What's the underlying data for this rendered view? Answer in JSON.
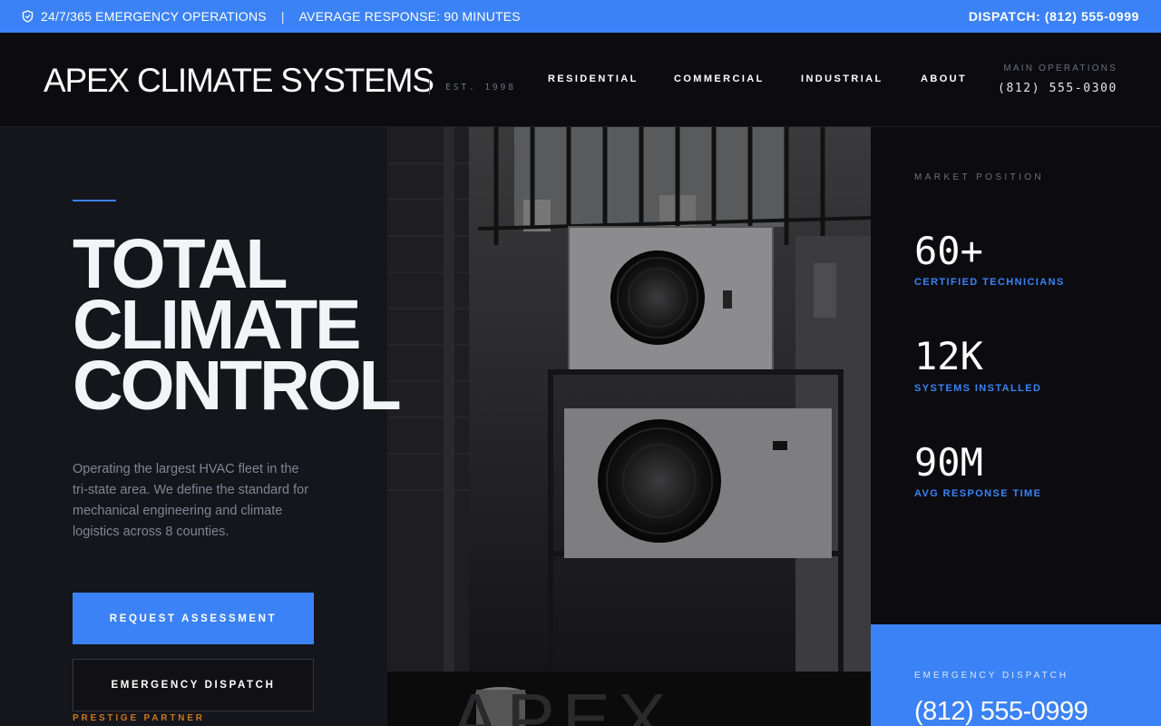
{
  "topbar": {
    "operations": "24/7/365 EMERGENCY OPERATIONS",
    "separator": "|",
    "response": "AVERAGE RESPONSE: 90 MINUTES",
    "dispatch": "DISPATCH: (812) 555-0999",
    "icon": "shield-icon"
  },
  "header": {
    "brand": "APEX CLIMATE SYSTEMS",
    "est": "EST. 1998",
    "nav": [
      "RESIDENTIAL",
      "COMMERCIAL",
      "INDUSTRIAL",
      "ABOUT"
    ],
    "ops_label": "MAIN OPERATIONS",
    "ops_phone": "(812) 555-0300"
  },
  "hero": {
    "headline": [
      "TOTAL",
      "CLIMATE",
      "CONTROL"
    ],
    "description": "Operating the largest HVAC fleet in the tri-state area. We define the standard for mechanical engineering and climate logistics across 8 counties.",
    "primary_button": "REQUEST ASSESSMENT",
    "secondary_button": "EMERGENCY DISPATCH",
    "partner": "PRESTIGE PARTNER",
    "image_watermark": "APEX"
  },
  "stats": {
    "label": "MARKET POSITION",
    "items": [
      {
        "value": "60+",
        "caption": "CERTIFIED TECHNICIANS"
      },
      {
        "value": "12K",
        "caption": "SYSTEMS INSTALLED"
      },
      {
        "value": "90M",
        "caption": "AVG RESPONSE TIME"
      }
    ]
  },
  "dispatch_box": {
    "label": "EMERGENCY DISPATCH",
    "phone": "(812) 555-0999"
  },
  "colors": {
    "accent": "#3b82f6",
    "partner": "#c8761f",
    "background": "#121217"
  }
}
